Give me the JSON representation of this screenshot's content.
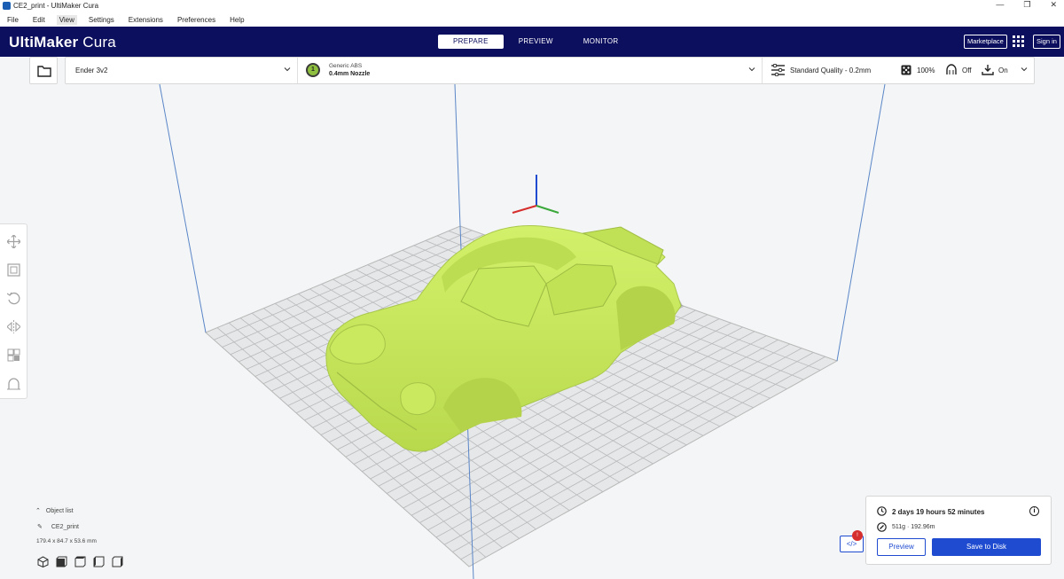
{
  "window": {
    "title": "CE2_print - UltiMaker Cura",
    "controls": [
      "—",
      "❐",
      "✕"
    ]
  },
  "menu": [
    "File",
    "Edit",
    "View",
    "Settings",
    "Extensions",
    "Preferences",
    "Help"
  ],
  "header": {
    "logo_strong": "UltiMaker",
    "logo_light": " Cura",
    "tabs": [
      "PREPARE",
      "PREVIEW",
      "MONITOR"
    ],
    "active_tab": "PREPARE",
    "marketplace": "Marketplace",
    "signin": "Sign in"
  },
  "printer": {
    "name": "Ender 3v2"
  },
  "material": {
    "extruder": "1",
    "name": "Generic ABS",
    "nozzle": "0.4mm Nozzle",
    "badge_color": "#8fbf3f"
  },
  "print_settings": {
    "profile": "Standard Quality - 0.2mm",
    "infill": "100%",
    "support": "Off",
    "adhesion": "On"
  },
  "object_list": {
    "toggle": "Object list",
    "object_name": "CE2_print",
    "dimensions": "179.4 x 84.7 x 53.6 mm"
  },
  "xray": {
    "icon": "</>",
    "badge": "!"
  },
  "action": {
    "print_time": "2 days 19 hours 52 minutes",
    "material_usage": "511g · 192.96m",
    "preview_button": "Preview",
    "save_button": "Save to Disk"
  },
  "colors": {
    "header": "#0c0e5e",
    "accent": "#1f4bd1",
    "model": "#c9ec5b",
    "alert": "#d62d2d"
  }
}
